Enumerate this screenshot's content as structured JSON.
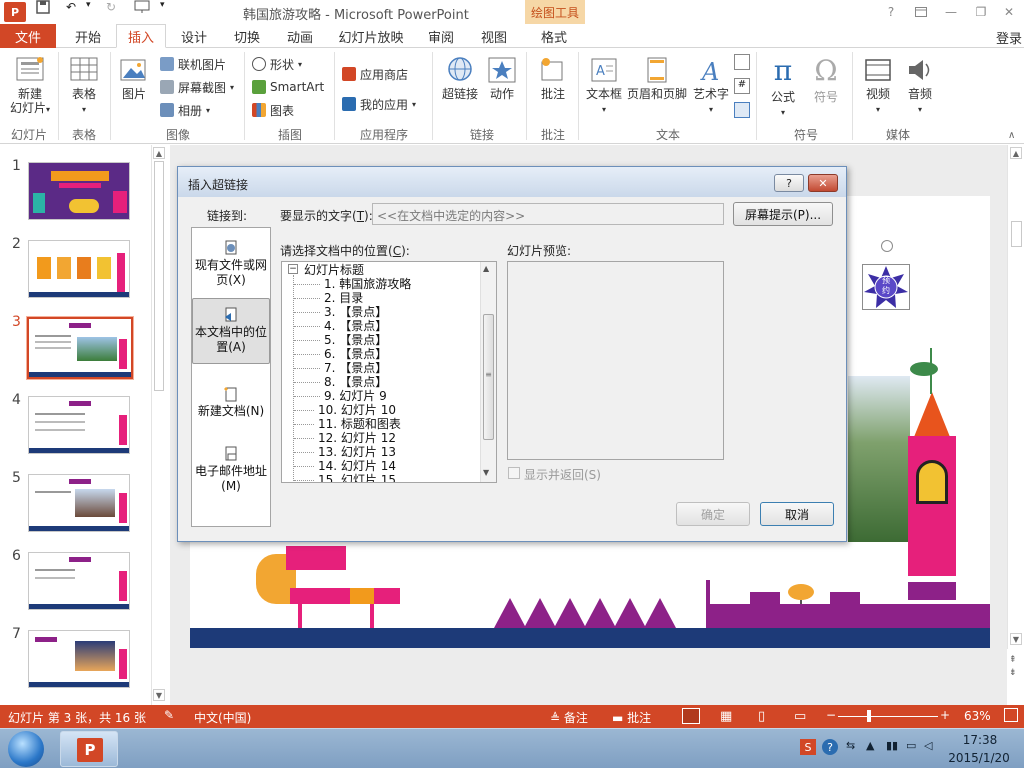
{
  "window": {
    "title": "韩国旅游攻略 - Microsoft PowerPoint",
    "context_tab_header": "绘图工具",
    "help": "?",
    "signin": "登录"
  },
  "tabs": [
    "文件",
    "开始",
    "插入",
    "设计",
    "切换",
    "动画",
    "幻灯片放映",
    "审阅",
    "视图",
    "格式"
  ],
  "active_tab": "插入",
  "ribbon": {
    "groups": [
      {
        "label": "幻灯片",
        "items": [
          "新建\n幻灯片"
        ]
      },
      {
        "label": "表格",
        "items": [
          "表格"
        ]
      },
      {
        "label": "图像",
        "items": [
          "图片",
          "联机图片",
          "屏幕截图",
          "相册"
        ]
      },
      {
        "label": "插图",
        "items": [
          "形状",
          "SmartArt",
          "图表"
        ]
      },
      {
        "label": "应用程序",
        "items": [
          "应用商店",
          "我的应用"
        ]
      },
      {
        "label": "链接",
        "items": [
          "超链接",
          "动作"
        ]
      },
      {
        "label": "批注",
        "items": [
          "批注"
        ]
      },
      {
        "label": "文本",
        "items": [
          "文本框",
          "页眉和页脚",
          "艺术字"
        ]
      },
      {
        "label": "符号",
        "items": [
          "公式",
          "符号"
        ]
      },
      {
        "label": "媒体",
        "items": [
          "视频",
          "音频"
        ]
      }
    ],
    "new_slide_line1": "新建",
    "new_slide_line2": "幻灯片"
  },
  "thumbnails": {
    "numbers": [
      "1",
      "2",
      "3",
      "4",
      "5",
      "6",
      "7"
    ],
    "selected": "3"
  },
  "dialog": {
    "title": "插入超链接",
    "help_btn": "?",
    "close_btn": "✕",
    "link_to_label": "链接到:",
    "display_text_label": "要显示的文字(T):",
    "display_text_value": "<<在文档中选定的内容>>",
    "screentip_btn": "屏幕提示(P)...",
    "select_place_label": "请选择文档中的位置(C):",
    "preview_label": "幻灯片预览:",
    "show_return_label": "显示并返回(S)",
    "ok_btn": "确定",
    "cancel_btn": "取消",
    "link_options": [
      {
        "line1": "现有文件或网",
        "line2": "页(X)"
      },
      {
        "line1": "本文档中的位",
        "line2": "置(A)"
      },
      {
        "line1": "新建文档(N)",
        "line2": ""
      },
      {
        "line1": "电子邮件地址",
        "line2": "(M)"
      }
    ],
    "tree_root": "幻灯片标题",
    "tree_items": [
      "1.  韩国旅游攻略",
      "2.  目录",
      "3.  【景点】",
      "4.  【景点】",
      "5.  【景点】",
      "6.  【景点】",
      "7.  【景点】",
      "8.  【景点】",
      "9.  幻灯片 9",
      "10.  幻灯片 10",
      "11.  标题和图表",
      "12.  幻灯片 12",
      "13.  幻灯片 13",
      "14.  幻灯片 14",
      "15.  幻灯片 15"
    ]
  },
  "slide_text": {
    "badge_line1": "预",
    "badge_line2": "约"
  },
  "status": {
    "slide_info": "幻灯片 第 3 张，共 16 张",
    "language": "中文(中国)",
    "notes": "备注",
    "comments": "批注",
    "zoom": "63%"
  },
  "taskbar": {
    "time": "17:38",
    "date": "2015/1/20"
  },
  "colors": {
    "accent": "#d24726",
    "slide_navy": "#1d3a78",
    "slide_purple": "#8d2188",
    "slide_pink": "#e6207b"
  }
}
